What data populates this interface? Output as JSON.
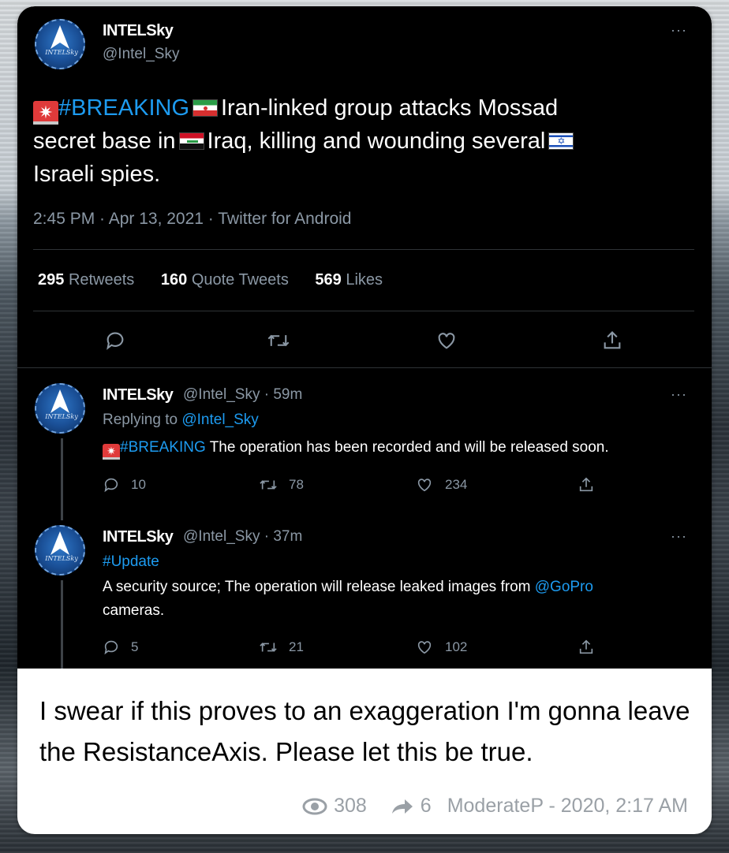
{
  "tweet": {
    "name": "INTELSky",
    "handle": "@Intel_Sky",
    "more": "···",
    "hashtag": "#BREAKING",
    "text_1": "Iran-linked group attacks Mossad",
    "text_2": "secret base in",
    "text_3": "Iraq, killing and wounding several",
    "text_4": "Israeli spies.",
    "meta": "2:45 PM · Apr 13, 2021 · Twitter for Android",
    "stats": {
      "retweets_count": "295",
      "retweets_label": "Retweets",
      "quotes_count": "160",
      "quotes_label": "Quote Tweets",
      "likes_count": "569",
      "likes_label": "Likes"
    }
  },
  "replies": [
    {
      "name": "INTELSky",
      "handle_time": "@Intel_Sky · 59m",
      "replying_label": "Replying to",
      "replying_to": "@Intel_Sky",
      "hashtag": "#BREAKING",
      "text": "The operation has been recorded and will be released soon.",
      "replies": "10",
      "retweets": "78",
      "likes": "234",
      "more": "···"
    },
    {
      "name": "INTELSky",
      "handle_time": "@Intel_Sky · 37m",
      "hashtag": "#Update",
      "text_1": "A security source;  The operation will release leaked images from",
      "mention": "@GoPro",
      "text_2": "cameras.",
      "replies": "5",
      "retweets": "21",
      "likes": "102",
      "more": "···"
    }
  ],
  "post": {
    "caption": "I swear if this proves to an exaggeration I'm gonna leave the ResistanceAxis. Please let this be true.",
    "views": "308",
    "forwards": "6",
    "author_time": "ModerateP - 2020, 2:17 AM"
  },
  "avatar_label": "INTELSky",
  "colors": {
    "link": "#1d9bf0",
    "tweet_bg": "#000000",
    "muted": "#8b98a5",
    "card_bg": "#ffffff"
  },
  "icons": [
    "reply-icon",
    "retweet-icon",
    "like-icon",
    "share-icon",
    "eye-icon",
    "forward-icon",
    "siren-icon"
  ]
}
